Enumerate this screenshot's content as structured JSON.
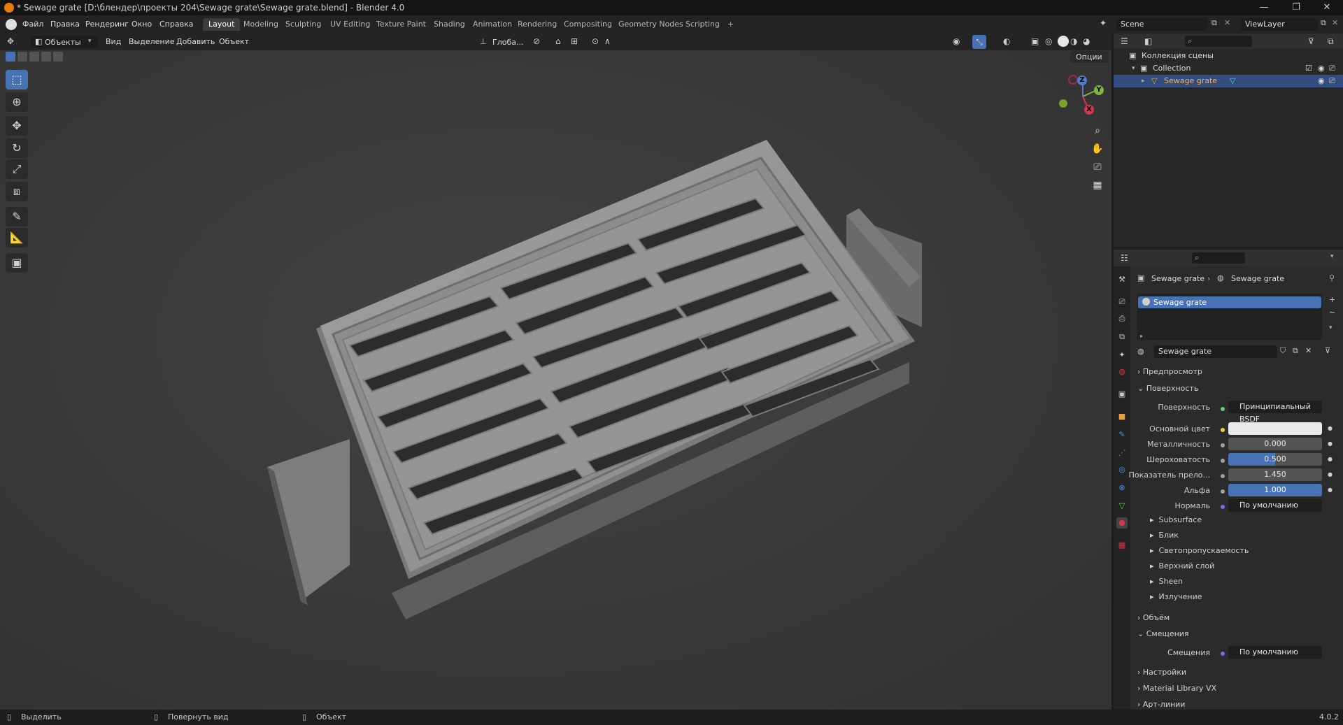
{
  "window": {
    "title": "* Sewage grate [D:\\блендер\\проекты 204\\Sewage grate\\Sewage grate.blend] - Blender 4.0",
    "min": "—",
    "max": "❐",
    "close": "✕"
  },
  "menu": [
    "Файл",
    "Правка",
    "Рендеринг",
    "Окно",
    "Справка"
  ],
  "workspaces": [
    "Layout",
    "Modeling",
    "Sculpting",
    "UV Editing",
    "Texture Paint",
    "Shading",
    "Animation",
    "Rendering",
    "Compositing",
    "Geometry Nodes",
    "Scripting",
    "+"
  ],
  "scene": {
    "name": "Scene",
    "view_layer": "ViewLayer"
  },
  "viewport": {
    "mode": "Объекты",
    "menus": [
      "Вид",
      "Выделение",
      "Добавить",
      "Объект"
    ],
    "orientation": "Глоба...",
    "options": "Опции"
  },
  "gizmo": {
    "z": "Z",
    "y": "Y",
    "x": "X"
  },
  "outliner": {
    "scene_collection": "Коллекция сцены",
    "collection": "Collection",
    "object": "Sewage grate"
  },
  "properties": {
    "breadcrumb_object": "Sewage grate",
    "breadcrumb_material": "Sewage grate",
    "slot": "Sewage grate",
    "material_name": "Sewage grate",
    "sections": {
      "preview": "Предпросмотр",
      "surface": "Поверхность",
      "volume": "Объём",
      "displacement": "Смещения",
      "settings": "Настройки",
      "material_library": "Material Library VX",
      "lineart": "Арт-линии"
    },
    "surface_label": "Поверхность",
    "surface_value": "Принципиальный BSDF",
    "base_color_label": "Основной цвет",
    "base_color": "#e9e9e9",
    "metallic_label": "Металличность",
    "metallic": "0.000",
    "roughness_label": "Шероховатость",
    "roughness": "0.500",
    "ior_label": "Показатель прело...",
    "ior": "1.450",
    "alpha_label": "Альфа",
    "alpha": "1.000",
    "normal_label": "Нормаль",
    "normal": "По умолчанию",
    "subsections": [
      "Subsurface",
      "Блик",
      "Светопропускаемость",
      "Верхний слой",
      "Sheen",
      "Излучение"
    ],
    "displacement_label": "Смещения",
    "displacement_value": "По умолчанию"
  },
  "statusbar": {
    "select": "Выделить",
    "rotate": "Повернуть вид",
    "object": "Объект",
    "version": "4.0.2"
  }
}
